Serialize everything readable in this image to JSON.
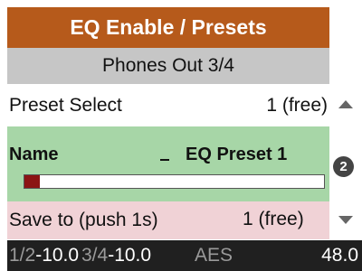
{
  "header": {
    "title": "EQ Enable / Presets",
    "subtitle": "Phones Out 3/4"
  },
  "rows": {
    "preset": {
      "label": "Preset Select",
      "value": "1 (free)"
    },
    "name": {
      "label": "Name",
      "value": "EQ Preset 1",
      "cursor": "_",
      "fill_fraction": 0.05
    },
    "save": {
      "label": "Save to (push 1s)",
      "value": "1 (free)"
    }
  },
  "badge": "2",
  "status": {
    "seg1_channel": "1/2",
    "seg1_level": "-10.0",
    "seg2_channel": "3/4",
    "seg2_level": "-10.0",
    "seg3": "AES",
    "seg4": "48.0"
  },
  "colors": {
    "title_bg": "#b65a1b",
    "subtitle_bg": "#c6c6c6",
    "name_bg": "#a7d6a7",
    "save_bg": "#f0d2d6",
    "status_bg": "#202020",
    "slider_fill": "#8b1414"
  },
  "icons": {
    "up": "triangle-up",
    "down": "triangle-down",
    "badge": "circled-number"
  }
}
